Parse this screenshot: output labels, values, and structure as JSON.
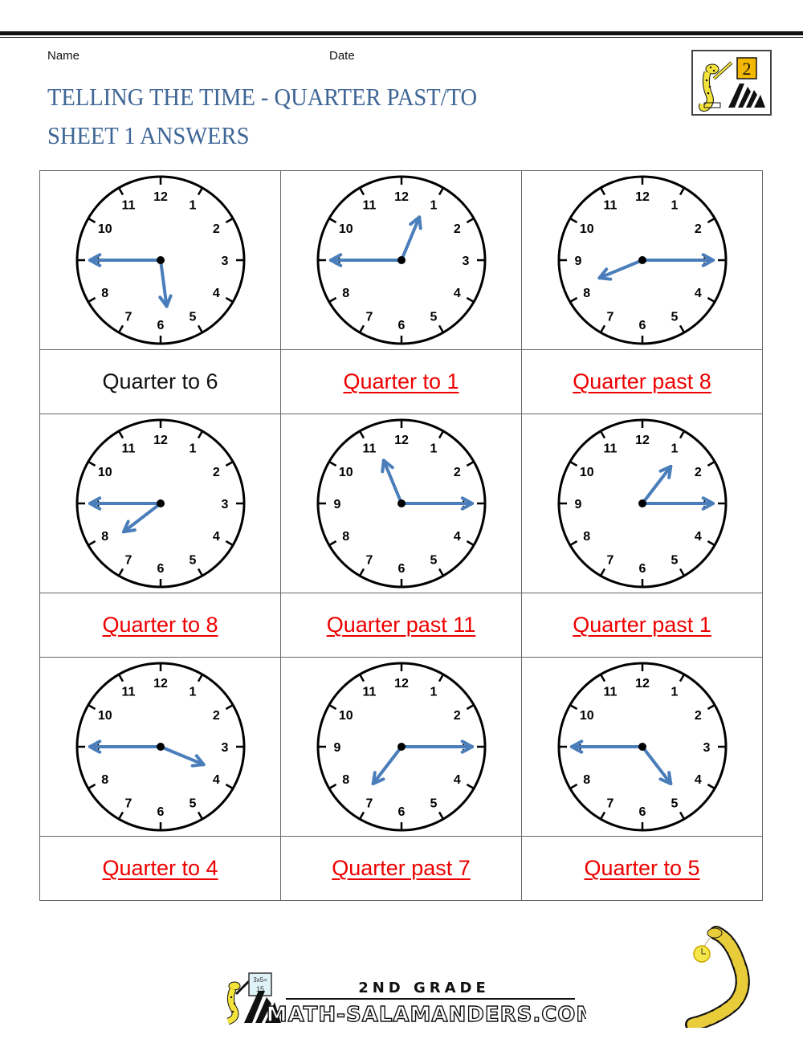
{
  "header": {
    "name_label": "Name",
    "date_label": "Date",
    "title_line1": "TELLING THE TIME - QUARTER PAST/TO",
    "title_line2": "SHEET 1 ANSWERS",
    "title_color": "#3d6595",
    "logo_grade": "2"
  },
  "clock_style": {
    "hand_color": "#4a7ebb",
    "face_stroke": "#000000",
    "numbers": [
      "12",
      "1",
      "2",
      "3",
      "4",
      "5",
      "6",
      "7",
      "8",
      "9",
      "10",
      "11"
    ]
  },
  "rows": [
    {
      "clocks": [
        {
          "hour": 5,
          "minute": 45,
          "answer": "Quarter to 6",
          "is_example": true
        },
        {
          "hour": 12,
          "minute": 45,
          "answer": "Quarter to 1",
          "is_example": false
        },
        {
          "hour": 8,
          "minute": 15,
          "answer": "Quarter past 8",
          "is_example": false
        }
      ]
    },
    {
      "clocks": [
        {
          "hour": 7,
          "minute": 45,
          "answer": "Quarter to 8",
          "is_example": false
        },
        {
          "hour": 11,
          "minute": 15,
          "answer": "Quarter past 11",
          "is_example": false
        },
        {
          "hour": 1,
          "minute": 15,
          "answer": "Quarter past 1",
          "is_example": false
        }
      ]
    },
    {
      "clocks": [
        {
          "hour": 3,
          "minute": 45,
          "answer": "Quarter to 4",
          "is_example": false
        },
        {
          "hour": 7,
          "minute": 15,
          "answer": "Quarter past 7",
          "is_example": false
        },
        {
          "hour": 4,
          "minute": 45,
          "answer": "Quarter to 5",
          "is_example": false
        }
      ]
    }
  ],
  "footer": {
    "grade_text": "2ND GRADE",
    "site_text": "MATH-SALAMANDERS.COM",
    "board_text_top": "3x5=",
    "board_text_bottom": "15"
  }
}
